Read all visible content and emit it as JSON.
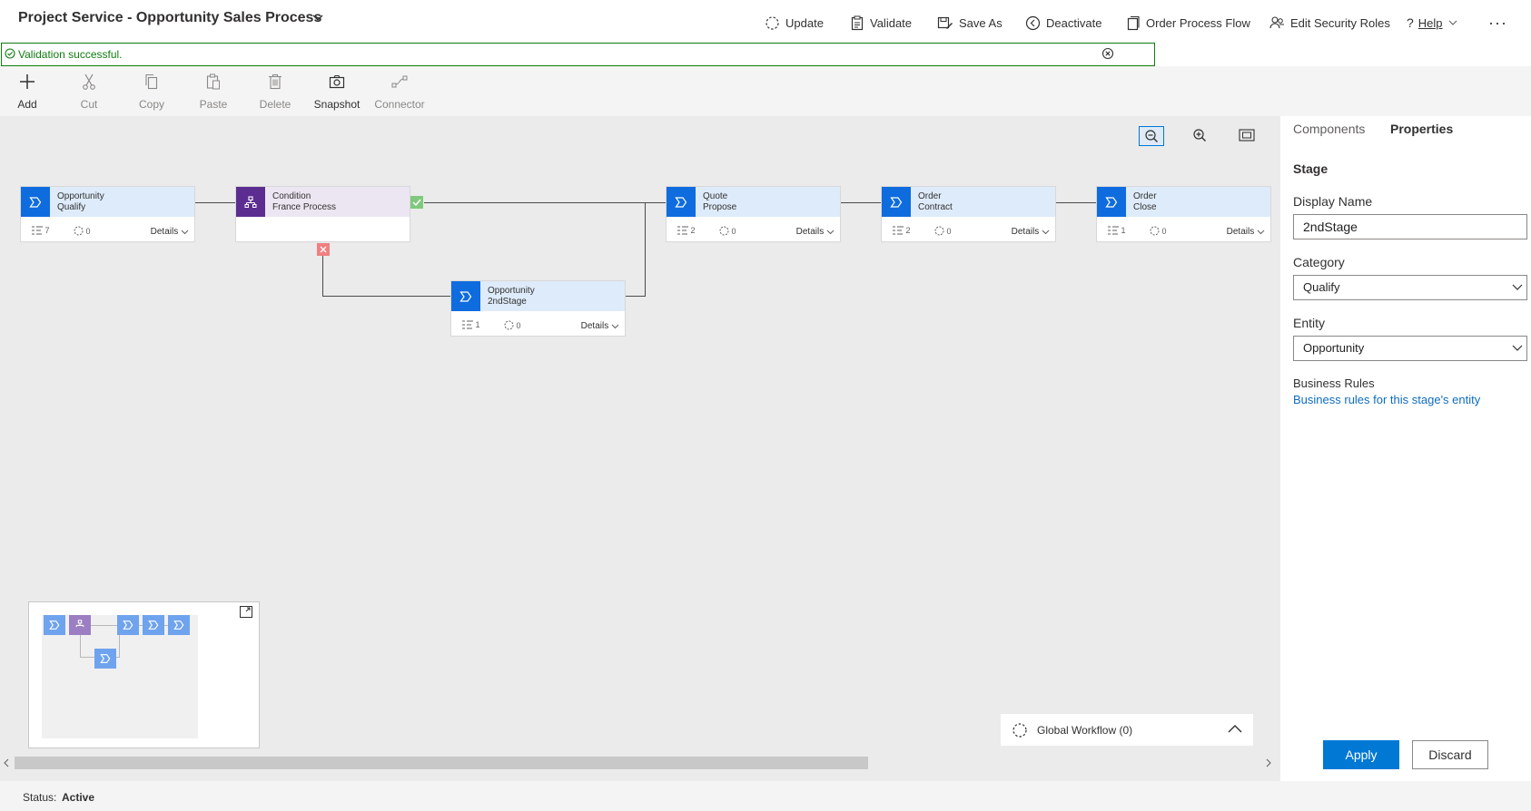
{
  "header": {
    "title": "Project Service - Opportunity Sales Process",
    "commands": [
      {
        "label": "Update",
        "icon": "refresh-icon"
      },
      {
        "label": "Validate",
        "icon": "clipboard-check-icon"
      },
      {
        "label": "Save As",
        "icon": "save-as-icon"
      },
      {
        "label": "Deactivate",
        "icon": "deactivate-icon"
      },
      {
        "label": "Order Process Flow",
        "icon": "order-icon"
      },
      {
        "label": "Edit Security Roles",
        "icon": "security-roles-icon"
      },
      {
        "label": "Help",
        "icon": "help-icon"
      }
    ],
    "more_icon": "more-icon"
  },
  "validation": {
    "message": "Validation successful.",
    "color": "#107c10"
  },
  "toolbar": {
    "items": [
      {
        "label": "Add",
        "icon": "plus-icon",
        "enabled": true
      },
      {
        "label": "Cut",
        "icon": "scissors-icon",
        "enabled": false
      },
      {
        "label": "Copy",
        "icon": "copy-icon",
        "enabled": false
      },
      {
        "label": "Paste",
        "icon": "paste-icon",
        "enabled": false
      },
      {
        "label": "Delete",
        "icon": "trash-icon",
        "enabled": false
      },
      {
        "label": "Snapshot",
        "icon": "camera-icon",
        "enabled": true
      },
      {
        "label": "Connector",
        "icon": "connector-icon",
        "enabled": false
      }
    ]
  },
  "canvas": {
    "stages": [
      {
        "entity": "Opportunity",
        "name": "Qualify",
        "steps": "7",
        "workflows": "0",
        "details": "Details"
      },
      {
        "entity": "Condition",
        "name": "France Process",
        "type": "condition"
      },
      {
        "entity": "Opportunity",
        "name": "2ndStage",
        "steps": "1",
        "workflows": "0",
        "details": "Details"
      },
      {
        "entity": "Quote",
        "name": "Propose",
        "steps": "2",
        "workflows": "0",
        "details": "Details"
      },
      {
        "entity": "Order",
        "name": "Contract",
        "steps": "2",
        "workflows": "0",
        "details": "Details"
      },
      {
        "entity": "Order",
        "name": "Close",
        "steps": "1",
        "workflows": "0",
        "details": "Details"
      }
    ],
    "global_workflow": "Global Workflow (0)",
    "colors": {
      "stage_blue": "#0f6cde",
      "condition_purple": "#5c2d91",
      "true_green": "#7fc97f",
      "false_red": "#f08080"
    }
  },
  "panel": {
    "tabs": [
      "Components",
      "Properties"
    ],
    "active_tab": "Properties",
    "section": "Stage",
    "display_name": {
      "label": "Display Name",
      "value": "2ndStage"
    },
    "category": {
      "label": "Category",
      "value": "Qualify"
    },
    "entity": {
      "label": "Entity",
      "value": "Opportunity"
    },
    "business_rules": {
      "label": "Business Rules",
      "link": "Business rules for this stage's entity"
    },
    "apply": "Apply",
    "discard": "Discard"
  },
  "status": {
    "label": "Status:",
    "value": "Active"
  }
}
